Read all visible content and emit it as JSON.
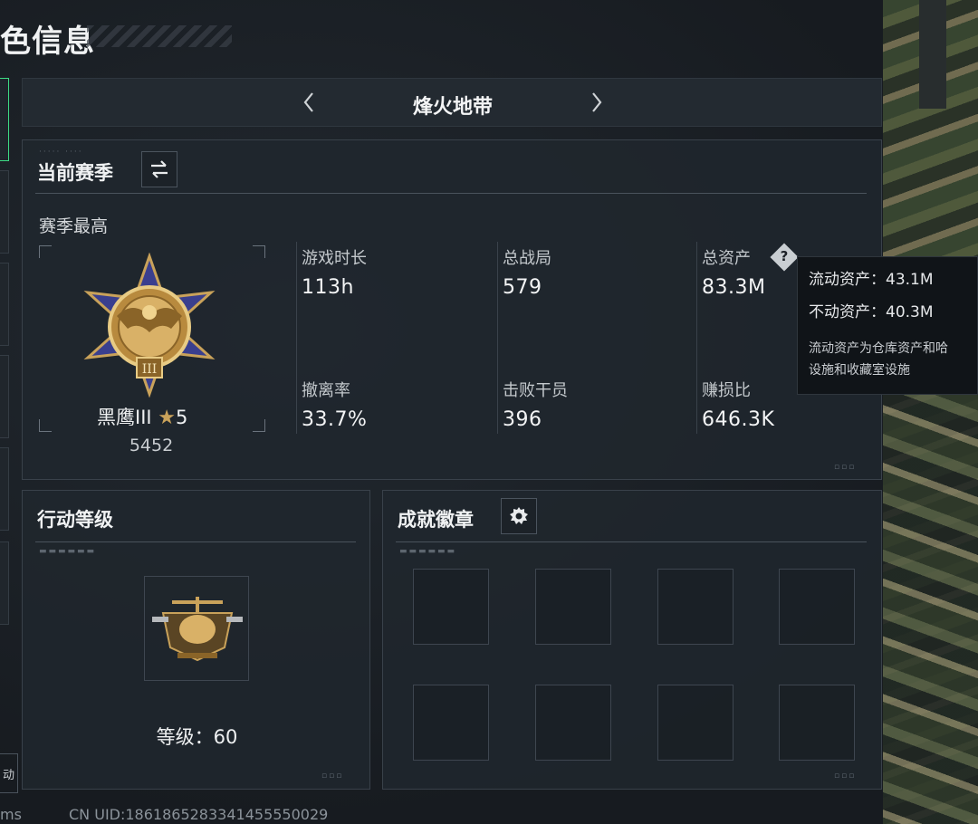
{
  "page_title": "色信息",
  "mode_header": {
    "title": "烽火地带",
    "prev_icon": "chevron-left-icon",
    "next_icon": "chevron-right-icon"
  },
  "season_panel": {
    "title": "当前赛季",
    "switch_icon": "swap-arrows-icon",
    "sub_title": "赛季最高",
    "rank_name": "黑鹰III",
    "rank_star_icon": "star-icon",
    "rank_stars": "5",
    "rank_points": "5452",
    "stats": [
      {
        "label": "游戏时长",
        "value": "113h"
      },
      {
        "label": "总战局",
        "value": "579"
      },
      {
        "label": "总资产",
        "value": "83.3M"
      },
      {
        "label": "撤离率",
        "value": "33.7%"
      },
      {
        "label": "击败干员",
        "value": "396"
      },
      {
        "label": "赚损比",
        "value": "646.3K"
      }
    ],
    "help_label": "?"
  },
  "tooltip": {
    "liquid": "流动资产：43.1M",
    "fixed": "不动资产：40.3M",
    "note_line1": "流动资产为仓库资产和哈",
    "note_line2": "设施和收藏室设施"
  },
  "action_panel": {
    "title": "行动等级",
    "level_text": "等级：60"
  },
  "badge_panel": {
    "title": "成就徽章",
    "settings_icon": "gear-icon",
    "slots": 8
  },
  "footer": {
    "ms": "ms",
    "uid": "CN UID:1861865283341455550029"
  },
  "sidebar_fragment": "动",
  "colors": {
    "accent_green": "#3ddc84",
    "accent_yellow": "#f2c230",
    "gold": "#c9a25a",
    "panel_bg": "#20272e"
  }
}
